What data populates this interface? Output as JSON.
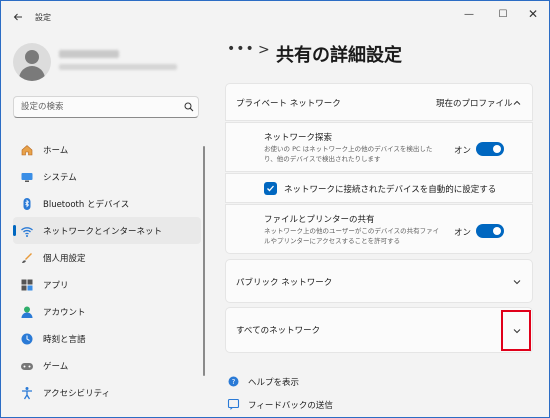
{
  "window": {
    "app_title": "設定",
    "controls": {
      "minimize": "—",
      "maximize": "☐",
      "close": "✕"
    }
  },
  "search": {
    "placeholder": "設定の検索"
  },
  "sidebar": {
    "items": [
      {
        "label": "ホーム",
        "icon": "home-icon",
        "selected": false
      },
      {
        "label": "システム",
        "icon": "system-icon",
        "selected": false
      },
      {
        "label": "Bluetooth とデバイス",
        "icon": "bluetooth-icon",
        "selected": false
      },
      {
        "label": "ネットワークとインターネット",
        "icon": "network-icon",
        "selected": true
      },
      {
        "label": "個人用設定",
        "icon": "personalization-icon",
        "selected": false
      },
      {
        "label": "アプリ",
        "icon": "apps-icon",
        "selected": false
      },
      {
        "label": "アカウント",
        "icon": "account-icon",
        "selected": false
      },
      {
        "label": "時刻と言語",
        "icon": "time-language-icon",
        "selected": false
      },
      {
        "label": "ゲーム",
        "icon": "gaming-icon",
        "selected": false
      },
      {
        "label": "アクセシビリティ",
        "icon": "accessibility-icon",
        "selected": false
      }
    ]
  },
  "breadcrumb": {
    "dots": "•••",
    "separator": ">"
  },
  "page": {
    "title": "共有の詳細設定"
  },
  "private_network": {
    "label": "プライベート ネットワーク",
    "status": "現在のプロファイル",
    "discovery": {
      "title": "ネットワーク探索",
      "description": "お使いの PC はネットワーク上の他のデバイスを検出したり、他のデバイスで検出されたりします",
      "toggle_label": "オン",
      "on": true
    },
    "auto_setup": {
      "label": "ネットワークに接続されたデバイスを自動的に設定する",
      "checked": true
    },
    "file_printer_sharing": {
      "title": "ファイルとプリンターの共有",
      "description": "ネットワーク上の他のユーザーがこのデバイスの共有ファイルやプリンターにアクセスすることを許可する",
      "toggle_label": "オン",
      "on": true
    }
  },
  "public_network": {
    "label": "パブリック ネットワーク"
  },
  "all_networks": {
    "label": "すべてのネットワーク"
  },
  "links": {
    "help": "ヘルプを表示",
    "feedback": "フィードバックの送信"
  },
  "colors": {
    "accent": "#0067c0",
    "highlight": "#e0001a"
  }
}
